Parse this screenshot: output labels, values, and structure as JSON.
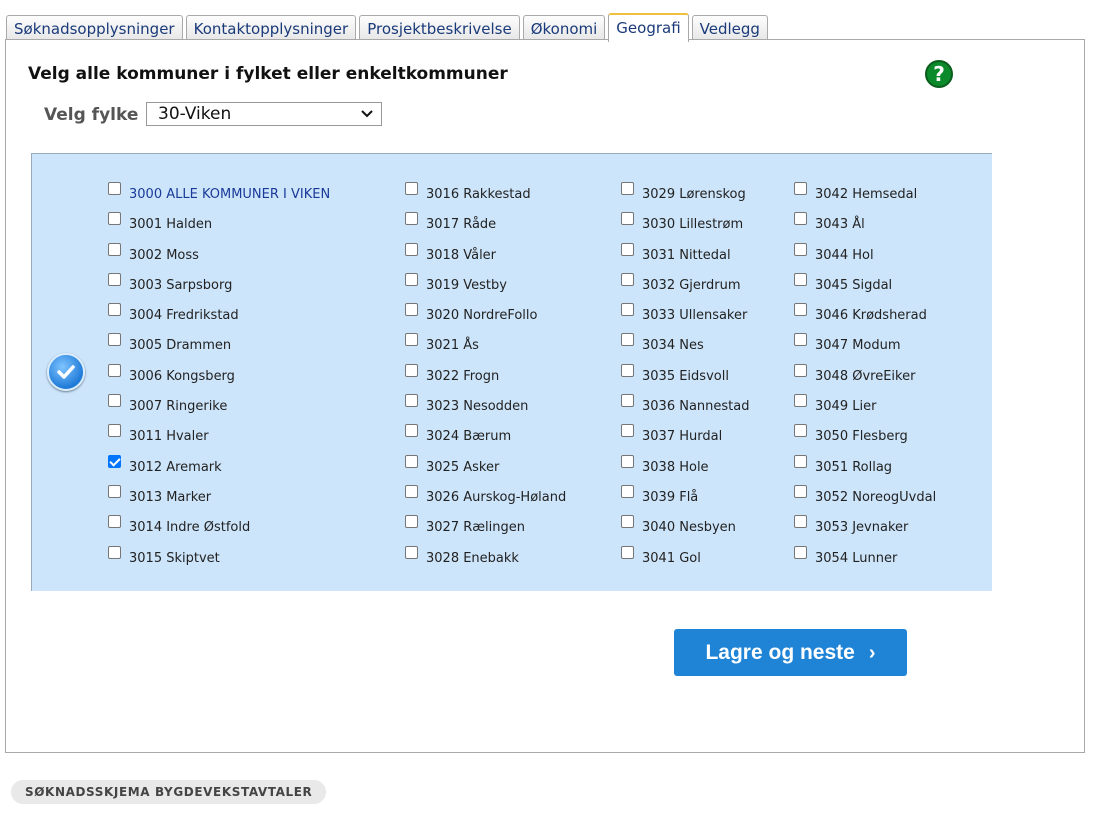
{
  "tabs": [
    "Søknadsopplysninger",
    "Kontaktopplysninger",
    "Prosjektbeskrivelse",
    "Økonomi",
    "Geografi",
    "Vedlegg"
  ],
  "active_tab": "Geografi",
  "heading": "Velg alle kommuner i fylket eller enkeltkommuner",
  "help_icon": "?",
  "fylke": {
    "label": "Velg fylke",
    "selected": "30-Viken"
  },
  "columns": [
    [
      {
        "label": "3000 ALLE KOMMUNER I VIKEN",
        "checked": false
      },
      {
        "label": "3001 Halden",
        "checked": false
      },
      {
        "label": "3002 Moss",
        "checked": false
      },
      {
        "label": "3003 Sarpsborg",
        "checked": false
      },
      {
        "label": "3004 Fredrikstad",
        "checked": false
      },
      {
        "label": "3005 Drammen",
        "checked": false
      },
      {
        "label": "3006 Kongsberg",
        "checked": false
      },
      {
        "label": "3007 Ringerike",
        "checked": false
      },
      {
        "label": "3011 Hvaler",
        "checked": false
      },
      {
        "label": "3012 Aremark",
        "checked": true
      },
      {
        "label": "3013 Marker",
        "checked": false
      },
      {
        "label": "3014 Indre Østfold",
        "checked": false
      },
      {
        "label": "3015 Skiptvet",
        "checked": false
      }
    ],
    [
      {
        "label": "3016 Rakkestad",
        "checked": false
      },
      {
        "label": "3017 Råde",
        "checked": false
      },
      {
        "label": "3018 Våler",
        "checked": false
      },
      {
        "label": "3019 Vestby",
        "checked": false
      },
      {
        "label": "3020 NordreFollo",
        "checked": false
      },
      {
        "label": "3021 Ås",
        "checked": false
      },
      {
        "label": "3022 Frogn",
        "checked": false
      },
      {
        "label": "3023 Nesodden",
        "checked": false
      },
      {
        "label": "3024 Bærum",
        "checked": false
      },
      {
        "label": "3025 Asker",
        "checked": false
      },
      {
        "label": "3026 Aurskog-Høland",
        "checked": false
      },
      {
        "label": "3027 Rælingen",
        "checked": false
      },
      {
        "label": "3028 Enebakk",
        "checked": false
      }
    ],
    [
      {
        "label": "3029 Lørenskog",
        "checked": false
      },
      {
        "label": "3030 Lillestrøm",
        "checked": false
      },
      {
        "label": "3031 Nittedal",
        "checked": false
      },
      {
        "label": "3032 Gjerdrum",
        "checked": false
      },
      {
        "label": "3033 Ullensaker",
        "checked": false
      },
      {
        "label": "3034 Nes",
        "checked": false
      },
      {
        "label": "3035 Eidsvoll",
        "checked": false
      },
      {
        "label": "3036 Nannestad",
        "checked": false
      },
      {
        "label": "3037 Hurdal",
        "checked": false
      },
      {
        "label": "3038 Hole",
        "checked": false
      },
      {
        "label": "3039 Flå",
        "checked": false
      },
      {
        "label": "3040 Nesbyen",
        "checked": false
      },
      {
        "label": "3041 Gol",
        "checked": false
      }
    ],
    [
      {
        "label": "3042 Hemsedal",
        "checked": false
      },
      {
        "label": "3043 Ål",
        "checked": false
      },
      {
        "label": "3044 Hol",
        "checked": false
      },
      {
        "label": "3045 Sigdal",
        "checked": false
      },
      {
        "label": "3046 Krødsherad",
        "checked": false
      },
      {
        "label": "3047 Modum",
        "checked": false
      },
      {
        "label": "3048 ØvreEiker",
        "checked": false
      },
      {
        "label": "3049 Lier",
        "checked": false
      },
      {
        "label": "3050 Flesberg",
        "checked": false
      },
      {
        "label": "3051 Rollag",
        "checked": false
      },
      {
        "label": "3052 NoreogUvdal",
        "checked": false
      },
      {
        "label": "3053 Jevnaker",
        "checked": false
      },
      {
        "label": "3054 Lunner",
        "checked": false
      }
    ]
  ],
  "save_button": {
    "label": "Lagre og neste",
    "arrow": "›"
  },
  "footer": "SØKNADSSKJEMA BYGDEVEKSTAVTALER",
  "colors": {
    "accent": "#1f84d6",
    "selection_bg": "#cde5fb",
    "help_green": "#0a8a2a",
    "active_tab_border": "#f0c040"
  }
}
